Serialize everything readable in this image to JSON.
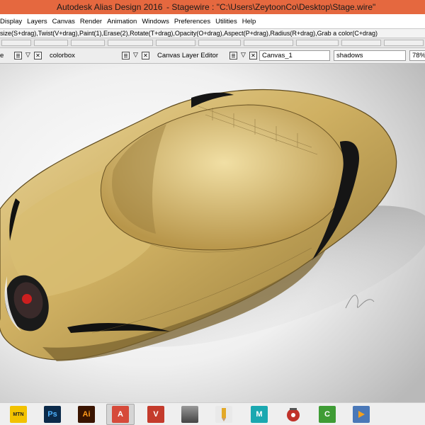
{
  "window": {
    "app_title": "Autodesk Alias Design 2016",
    "document_title": "- Stagewire : \"C:\\Users\\ZeytoonCo\\Desktop\\Stage.wire\""
  },
  "menu": {
    "items": [
      "Display",
      "Layers",
      "Canvas",
      "Render",
      "Animation",
      "Windows",
      "Preferences",
      "Utilities",
      "Help"
    ]
  },
  "hint": {
    "text": "size(S+drag),Twist(V+drag),Paint(1),Erase(2),Rotate(T+drag),Opacity(O+drag),Aspect(P+drag),Radius(R+drag),Grab a color(C+drag)"
  },
  "panels": {
    "left_label": "e",
    "colorbox_label": "colorbox",
    "layer_editor_label": "Canvas Layer Editor",
    "canvas_field": "Canvas_1",
    "layer_field": "shadows",
    "opacity_field": "78%"
  },
  "icons": {
    "panel_menu": "panel-menu-icon",
    "panel_dropdown": "dropdown-arrow-icon",
    "panel_close": "close-icon"
  },
  "taskbar": {
    "apps": [
      {
        "name": "mtn-irancell-app",
        "label": "MTN",
        "color": "#f2c200"
      },
      {
        "name": "photoshop-app",
        "label": "Ps",
        "color": "#0b2a4a"
      },
      {
        "name": "illustrator-app",
        "label": "Ai",
        "color": "#3a1400"
      },
      {
        "name": "alias-design-app",
        "label": "A",
        "color": "#d64a3a"
      },
      {
        "name": "vred-app",
        "label": "V",
        "color": "#c43b2c"
      },
      {
        "name": "portrait-app",
        "label": "",
        "color": "#777777"
      },
      {
        "name": "pencil-app",
        "label": "",
        "color": "#e9e9e9"
      },
      {
        "name": "maya-app",
        "label": "M",
        "color": "#1aa8b0"
      },
      {
        "name": "media-player-app",
        "label": "",
        "color": "#c0322a"
      },
      {
        "name": "camtasia-app",
        "label": "C",
        "color": "#3f9c35"
      },
      {
        "name": "player-app",
        "label": "",
        "color": "#4a78b8"
      }
    ]
  },
  "colors": {
    "titlebar": "#e5683f",
    "car_body": "#d4b76a",
    "car_shadow": "#6e5a2a",
    "accent_red": "#cc1f1f"
  }
}
